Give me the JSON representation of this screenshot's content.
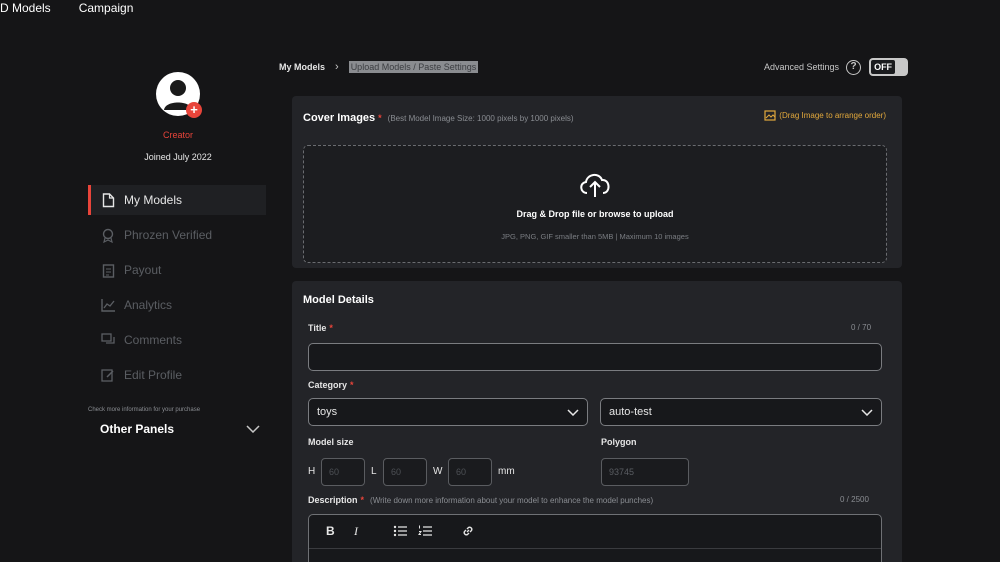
{
  "nav": {
    "item1": "D Models",
    "item2": "Campaign"
  },
  "profile": {
    "role": "Creator",
    "joined": "Joined July 2022",
    "badge": "+"
  },
  "sidebar": {
    "items": [
      {
        "label": "My Models",
        "icon": "document-icon"
      },
      {
        "label": "Phrozen Verified",
        "icon": "verified-badge-icon"
      },
      {
        "label": "Payout",
        "icon": "clipboard-icon"
      },
      {
        "label": "Analytics",
        "icon": "chart-icon"
      },
      {
        "label": "Comments",
        "icon": "comments-icon"
      },
      {
        "label": "Edit Profile",
        "icon": "edit-icon"
      }
    ],
    "check_more": "Check more information for your purchase",
    "other_panels": "Other Panels"
  },
  "breadcrumb": {
    "root": "My Models",
    "current": "Upload Models / Paste Settings"
  },
  "advanced": {
    "label": "Advanced Settings",
    "help": "?",
    "toggle": "OFF"
  },
  "cover": {
    "title": "Cover Images",
    "required": "*",
    "hint": "(Best Model Image Size: 1000 pixels by 1000 pixels)",
    "drag_hint": "(Drag Image to arrange order)",
    "drop_main": "Drag & Drop file or browse to upload",
    "drop_sub": "JPG, PNG, GIF smaller than 5MB | Maximum 10 images"
  },
  "details": {
    "title": "Model Details",
    "title_label": "Title",
    "title_counter": "0 / 70",
    "title_value": "",
    "category_label": "Category",
    "category_1": "toys",
    "category_2": "auto-test",
    "size_label": "Model size",
    "size_h": "H",
    "size_l": "L",
    "size_w": "W",
    "size_h_placeholder": "60",
    "size_l_placeholder": "60",
    "size_w_placeholder": "60",
    "size_unit": "mm",
    "polygon_label": "Polygon",
    "polygon_value": "93745",
    "desc_label": "Description",
    "desc_hint": "(Write down more information about your model to enhance the model punches)",
    "desc_counter": "0 / 2500",
    "toolbar": {
      "bold": "B",
      "italic": "I"
    }
  },
  "colors": {
    "accent": "#e8443a",
    "warning": "#e3a93c",
    "background": "#151517",
    "panel": "#232428"
  }
}
